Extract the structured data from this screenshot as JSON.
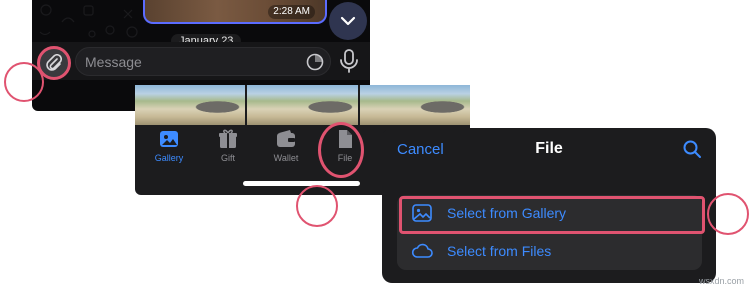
{
  "chat": {
    "photo_time": "2:28 AM",
    "date_badge": "January 23",
    "message_placeholder": "Message"
  },
  "attach_menu": {
    "tabs": [
      {
        "label": "Gallery",
        "icon": "gallery-icon",
        "active": true
      },
      {
        "label": "Gift",
        "icon": "gift-icon",
        "active": false
      },
      {
        "label": "Wallet",
        "icon": "wallet-icon",
        "active": false
      },
      {
        "label": "File",
        "icon": "file-icon",
        "active": false
      }
    ]
  },
  "file_sheet": {
    "cancel_label": "Cancel",
    "title": "File",
    "options": [
      {
        "label": "Select from Gallery",
        "icon": "image-icon"
      },
      {
        "label": "Select from Files",
        "icon": "cloud-icon"
      }
    ]
  },
  "watermark": "wsxdn.com",
  "colors": {
    "accent": "#3d8bff",
    "highlight_ring": "#e05370",
    "panel_bg": "#1c1c1e",
    "chat_bg": "#0a0a0c"
  }
}
